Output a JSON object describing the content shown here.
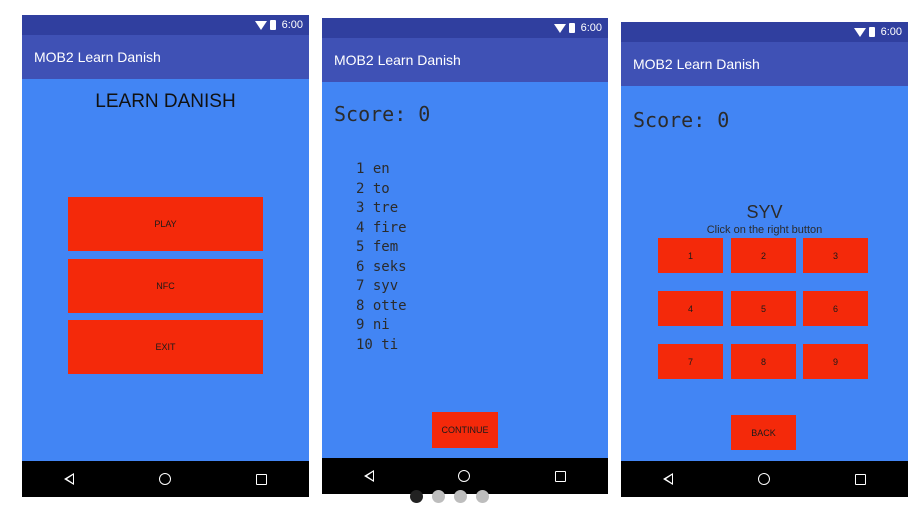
{
  "status": {
    "time": "6:00"
  },
  "app": {
    "title": "MOB2 Learn Danish"
  },
  "screen1": {
    "heading": "LEARN DANISH",
    "buttons": {
      "play": "PLAY",
      "nfc": "NFC",
      "exit": "EXIT"
    }
  },
  "screen2": {
    "score": "Score: 0",
    "numbers": [
      "1 en",
      "2 to",
      "3 tre",
      "4 fire",
      "5 fem",
      "6 seks",
      "7 syv",
      "8 otte",
      "9 ni",
      "10 ti"
    ],
    "continue_label": "CONTINUE"
  },
  "screen3": {
    "score": "Score: 0",
    "word": "SYV",
    "instruction": "Click on the right button",
    "grid": [
      "1",
      "2",
      "3",
      "4",
      "5",
      "6",
      "7",
      "8",
      "9"
    ],
    "back_label": "BACK"
  },
  "pager": {
    "count": 4,
    "active": 0
  },
  "colors": {
    "statusbar": "#303F9F",
    "appbar": "#3F51B5",
    "background": "#4285F4",
    "button": "#F4290A",
    "navbar": "#000000"
  }
}
